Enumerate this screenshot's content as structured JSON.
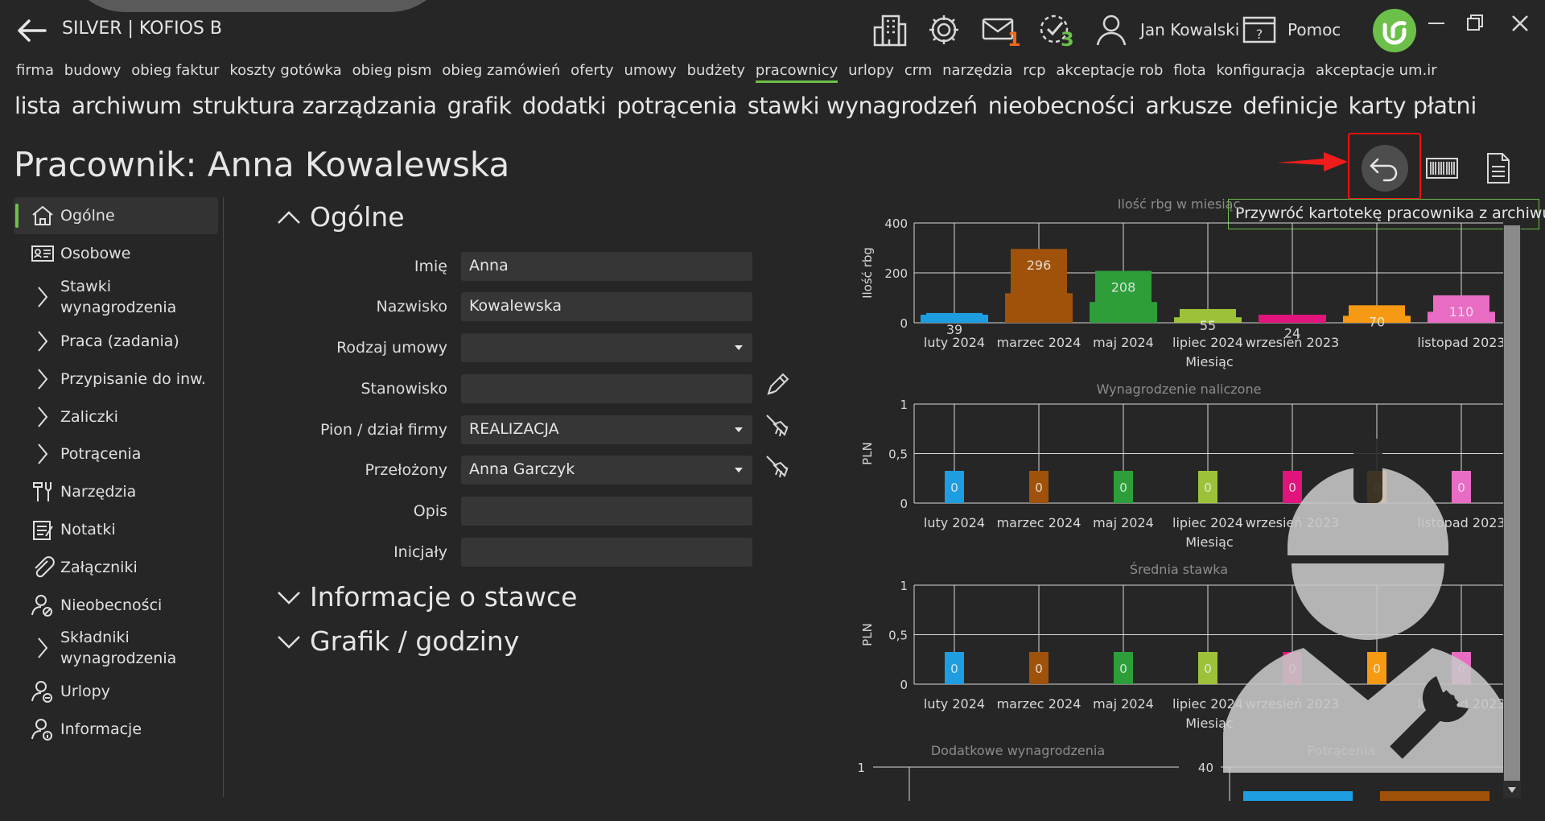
{
  "app": {
    "title": "SILVER | KOFIOS B"
  },
  "toolbar": {
    "mail_badge": "1",
    "tasks_badge": "3",
    "user_name": "Jan Kowalski",
    "help_label": "Pomoc"
  },
  "main_menu": [
    "firma",
    "budowy",
    "obieg faktur",
    "koszty gotówka",
    "obieg pism",
    "obieg zamówień",
    "oferty",
    "umowy",
    "budżety",
    "pracownicy",
    "urlopy",
    "crm",
    "narzędzia",
    "rcp",
    "akceptacje rob",
    "flota",
    "konfiguracja",
    "akceptacje um.ir"
  ],
  "main_menu_active": "pracownicy",
  "sub_menu": [
    "lista",
    "archiwum",
    "struktura zarządzania",
    "grafik",
    "dodatki",
    "potrącenia",
    "stawki wynagrodzeń",
    "nieobecności",
    "arkusze",
    "definicje",
    "karty płatni"
  ],
  "page": {
    "title": "Pracownik: Anna Kowalewska"
  },
  "tooltip": "Przywróć kartotekę pracownika z archiwum",
  "sidebar": {
    "items": [
      {
        "label": "Ogólne"
      },
      {
        "label": "Osobowe"
      },
      {
        "label": "Stawki wynagrodzenia"
      },
      {
        "label": "Praca (zadania)"
      },
      {
        "label": "Przypisanie do inw."
      },
      {
        "label": "Zaliczki"
      },
      {
        "label": "Potrącenia"
      },
      {
        "label": "Narzędzia"
      },
      {
        "label": "Notatki"
      },
      {
        "label": "Załączniki"
      },
      {
        "label": "Nieobecności"
      },
      {
        "label": "Składniki wynagrodzenia"
      },
      {
        "label": "Urlopy"
      },
      {
        "label": "Informacje"
      }
    ]
  },
  "form": {
    "section_general": "Ogólne",
    "section_rate": "Informacje o stawce",
    "section_schedule": "Grafik / godziny",
    "fields": [
      {
        "label": "Imię",
        "value": "Anna"
      },
      {
        "label": "Nazwisko",
        "value": "Kowalewska"
      },
      {
        "label": "Rodzaj umowy",
        "value": ""
      },
      {
        "label": "Stanowisko",
        "value": ""
      },
      {
        "label": "Pion / dział firmy",
        "value": "REALIZACJA"
      },
      {
        "label": "Przełożony",
        "value": "Anna Garczyk"
      },
      {
        "label": "Opis",
        "value": ""
      },
      {
        "label": "Inicjały",
        "value": ""
      }
    ]
  },
  "colors": {
    "accent": "#6cc04a",
    "highlight": "#e11111",
    "series": [
      "#1e9ee0",
      "#a0520a",
      "#2e9e3a",
      "#9dc23a",
      "#e0147a",
      "#f59a12",
      "#e86cc4"
    ]
  },
  "chart_data": [
    {
      "type": "bar",
      "title": "Ilość rbg w miesiąc",
      "xlabel": "Miesiąc",
      "ylabel": "Ilość rbg",
      "ylim": [
        0,
        400
      ],
      "yticks": [
        "400",
        "200",
        "0"
      ],
      "categories": [
        "luty 2024",
        "marzec 2024",
        "maj 2024",
        "lipiec 2024",
        "wrzesień 2023",
        "",
        "listopad 2023"
      ],
      "values": [
        39,
        296,
        208,
        55,
        24,
        70,
        110
      ]
    },
    {
      "type": "bar",
      "title": "Wynagrodzenie naliczone",
      "xlabel": "Miesiąc",
      "ylabel": "PLN",
      "ylim": [
        0,
        1
      ],
      "yticks": [
        "1",
        "0,5",
        "0"
      ],
      "categories": [
        "luty 2024",
        "marzec 2024",
        "maj 2024",
        "lipiec 2024",
        "wrzesień 2023",
        "",
        "listopad 2023"
      ],
      "values": [
        0,
        0,
        0,
        0,
        0,
        0,
        0
      ]
    },
    {
      "type": "bar",
      "title": "Średnia stawka",
      "xlabel": "Miesiąc",
      "ylabel": "PLN",
      "ylim": [
        0,
        1
      ],
      "yticks": [
        "1",
        "0,5",
        "0"
      ],
      "categories": [
        "luty 2024",
        "marzec 2024",
        "maj 2024",
        "lipiec 2024",
        "wrzesień 2023",
        "",
        "listopad 2023"
      ],
      "values": [
        0,
        0,
        0,
        0,
        0,
        0,
        0
      ]
    },
    {
      "type": "bar",
      "title": "Dodatkowe wynagrodzenia",
      "yticks": [
        "1"
      ]
    },
    {
      "type": "bar",
      "title": "Potrącenia",
      "yticks": [
        "40"
      ]
    }
  ]
}
